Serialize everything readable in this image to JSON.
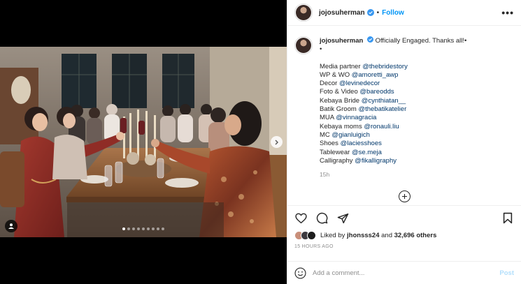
{
  "post": {
    "username": "jojosuherman",
    "follow_label": "Follow",
    "separator": "•",
    "more_label": "•••",
    "caption_text": "Officially Engaged. Thanks all!•",
    "caption_dot": "•",
    "credits": [
      {
        "label": "Media partner",
        "handle": "@thebridestory"
      },
      {
        "label": "WP & WO",
        "handle": "@amoretti_awp"
      },
      {
        "label": "Decor",
        "handle": "@levinedecor"
      },
      {
        "label": "Foto & Video",
        "handle": "@bareodds"
      },
      {
        "label": "Kebaya Bride",
        "handle": "@cynthiatan__"
      },
      {
        "label": "Batik Groom",
        "handle": "@thebatikatelier"
      },
      {
        "label": "MUA",
        "handle": "@vinnagracia"
      },
      {
        "label": "Kebaya moms",
        "handle": "@ronauli.liu"
      },
      {
        "label": "MC",
        "handle": "@gianluigich"
      },
      {
        "label": "Shoes",
        "handle": "@laciesshoes"
      },
      {
        "label": "Tablewear",
        "handle": "@se.meja"
      },
      {
        "label": "Calligraphy",
        "handle": "@fikalligraphy"
      }
    ],
    "caption_age": "15h",
    "likes": {
      "prefix": "Liked by",
      "user": "jhonsss24",
      "connector": "and",
      "others": "32,696 others"
    },
    "post_time": "15 HOURS AGO"
  },
  "carousel": {
    "slides": 9,
    "active_index": 0
  },
  "comment": {
    "placeholder": "Add a comment...",
    "post_label": "Post"
  },
  "colors": {
    "link": "#00376b",
    "follow": "#0095f6",
    "post_disabled": "#b2dffc",
    "muted": "#8e8e8e"
  },
  "icons": [
    "verified-badge-icon",
    "more-options-icon",
    "heart-icon",
    "comment-icon",
    "share-icon",
    "save-icon",
    "plus-circle-icon",
    "emoji-icon",
    "user-tag-icon",
    "chevron-right-icon"
  ]
}
